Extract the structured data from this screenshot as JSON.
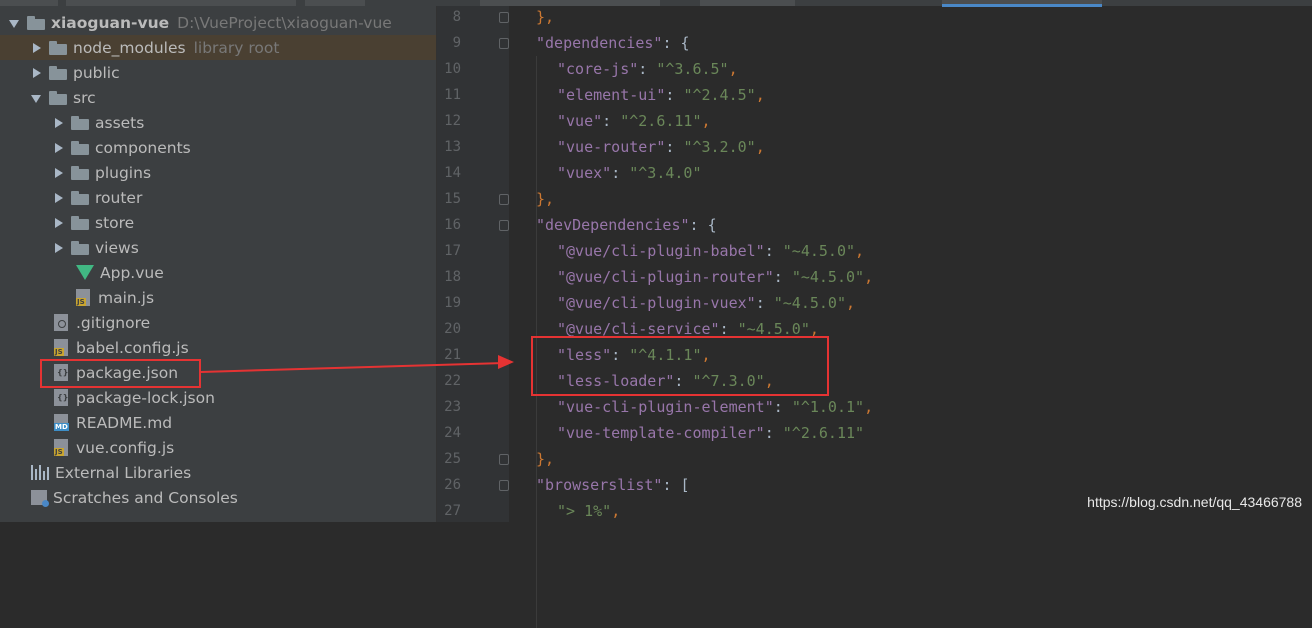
{
  "project": {
    "root_name": "xiaoguan-vue",
    "root_path": "D:\\VueProject\\xiaoguan-vue",
    "items": [
      {
        "label": "node_modules",
        "hint": "library root"
      },
      {
        "label": "public"
      },
      {
        "label": "src"
      },
      {
        "label": "assets"
      },
      {
        "label": "components"
      },
      {
        "label": "plugins"
      },
      {
        "label": "router"
      },
      {
        "label": "store"
      },
      {
        "label": "views"
      },
      {
        "label": "App.vue"
      },
      {
        "label": "main.js"
      },
      {
        "label": ".gitignore"
      },
      {
        "label": "babel.config.js"
      },
      {
        "label": "package.json"
      },
      {
        "label": "package-lock.json"
      },
      {
        "label": "README.md"
      },
      {
        "label": "vue.config.js"
      },
      {
        "label": "External Libraries"
      },
      {
        "label": "Scratches and Consoles"
      }
    ]
  },
  "editor": {
    "line_numbers": [
      "8",
      "9",
      "10",
      "11",
      "12",
      "13",
      "14",
      "15",
      "16",
      "17",
      "18",
      "19",
      "20",
      "21",
      "22",
      "23",
      "24",
      "25",
      "26",
      "27"
    ],
    "lines": [
      [
        {
          "t": "p",
          "v": "},"
        }
      ],
      [
        {
          "t": "k",
          "v": "\"dependencies\""
        },
        {
          "t": "n",
          "v": ": {"
        }
      ],
      [
        {
          "t": "k",
          "v": "\"core-js\""
        },
        {
          "t": "n",
          "v": ": "
        },
        {
          "t": "s",
          "v": "\"^3.6.5\""
        },
        {
          "t": "p",
          "v": ","
        }
      ],
      [
        {
          "t": "k",
          "v": "\"element-ui\""
        },
        {
          "t": "n",
          "v": ": "
        },
        {
          "t": "s",
          "v": "\"^2.4.5\""
        },
        {
          "t": "p",
          "v": ","
        }
      ],
      [
        {
          "t": "k",
          "v": "\"vue\""
        },
        {
          "t": "n",
          "v": ": "
        },
        {
          "t": "s",
          "v": "\"^2.6.11\""
        },
        {
          "t": "p",
          "v": ","
        }
      ],
      [
        {
          "t": "k",
          "v": "\"vue-router\""
        },
        {
          "t": "n",
          "v": ": "
        },
        {
          "t": "s",
          "v": "\"^3.2.0\""
        },
        {
          "t": "p",
          "v": ","
        }
      ],
      [
        {
          "t": "k",
          "v": "\"vuex\""
        },
        {
          "t": "n",
          "v": ": "
        },
        {
          "t": "s",
          "v": "\"^3.4.0\""
        }
      ],
      [
        {
          "t": "p",
          "v": "},"
        }
      ],
      [
        {
          "t": "k",
          "v": "\"devDependencies\""
        },
        {
          "t": "n",
          "v": ": {"
        }
      ],
      [
        {
          "t": "k",
          "v": "\"@vue/cli-plugin-babel\""
        },
        {
          "t": "n",
          "v": ": "
        },
        {
          "t": "s",
          "v": "\"~4.5.0\""
        },
        {
          "t": "p",
          "v": ","
        }
      ],
      [
        {
          "t": "k",
          "v": "\"@vue/cli-plugin-router\""
        },
        {
          "t": "n",
          "v": ": "
        },
        {
          "t": "s",
          "v": "\"~4.5.0\""
        },
        {
          "t": "p",
          "v": ","
        }
      ],
      [
        {
          "t": "k",
          "v": "\"@vue/cli-plugin-vuex\""
        },
        {
          "t": "n",
          "v": ": "
        },
        {
          "t": "s",
          "v": "\"~4.5.0\""
        },
        {
          "t": "p",
          "v": ","
        }
      ],
      [
        {
          "t": "k",
          "v": "\"@vue/cli-service\""
        },
        {
          "t": "n",
          "v": ": "
        },
        {
          "t": "s",
          "v": "\"~4.5.0\""
        },
        {
          "t": "p",
          "v": ","
        }
      ],
      [
        {
          "t": "k",
          "v": "\"less\""
        },
        {
          "t": "n",
          "v": ": "
        },
        {
          "t": "s",
          "v": "\"^4.1.1\""
        },
        {
          "t": "p",
          "v": ","
        }
      ],
      [
        {
          "t": "k",
          "v": "\"less-loader\""
        },
        {
          "t": "n",
          "v": ": "
        },
        {
          "t": "s",
          "v": "\"^7.3.0\""
        },
        {
          "t": "p",
          "v": ","
        }
      ],
      [
        {
          "t": "k",
          "v": "\"vue-cli-plugin-element\""
        },
        {
          "t": "n",
          "v": ": "
        },
        {
          "t": "s",
          "v": "\"^1.0.1\""
        },
        {
          "t": "p",
          "v": ","
        }
      ],
      [
        {
          "t": "k",
          "v": "\"vue-template-compiler\""
        },
        {
          "t": "n",
          "v": ": "
        },
        {
          "t": "s",
          "v": "\"^2.6.11\""
        }
      ],
      [
        {
          "t": "p",
          "v": "},"
        }
      ],
      [
        {
          "t": "k",
          "v": "\"browserslist\""
        },
        {
          "t": "n",
          "v": ": ["
        }
      ],
      [
        {
          "t": "s",
          "v": "\"> 1%\""
        },
        {
          "t": "p",
          "v": ","
        }
      ]
    ]
  },
  "watermark": "https://blog.csdn.net/qq_43466788",
  "colors": {
    "highlight": "#e53333",
    "key": "#9876aa",
    "string": "#6a8759",
    "punct": "#cc7832"
  }
}
